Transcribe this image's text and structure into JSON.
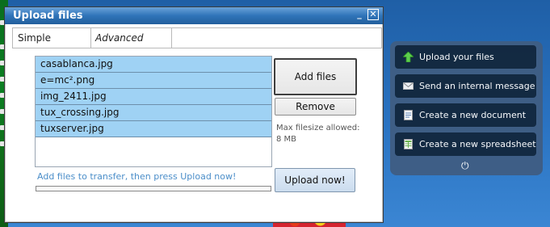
{
  "dialog": {
    "title": "Upload files",
    "minimize_label": "_",
    "close_label": "✕",
    "tabs": [
      {
        "label": "Simple"
      },
      {
        "label": "Advanced"
      }
    ],
    "files": [
      "casablanca.jpg",
      "e=mc².png",
      "img_2411.jpg",
      "tux_crossing.jpg",
      "tuxserver.jpg"
    ],
    "add_files_label": "Add files",
    "remove_label": "Remove",
    "max_filesize": "Max filesize allowed: 8 MB",
    "hint": "Add files to transfer, then press Upload now!",
    "upload_label": "Upload now!",
    "progress": 0
  },
  "panel": {
    "items": [
      {
        "label": "Upload your files",
        "icon": "upload-arrow-icon"
      },
      {
        "label": "Send an internal message",
        "icon": "envelope-icon"
      },
      {
        "label": "Create a new document",
        "icon": "document-icon"
      },
      {
        "label": "Create a new spreadsheet",
        "icon": "spreadsheet-icon"
      }
    ],
    "power_icon": "power-icon"
  }
}
